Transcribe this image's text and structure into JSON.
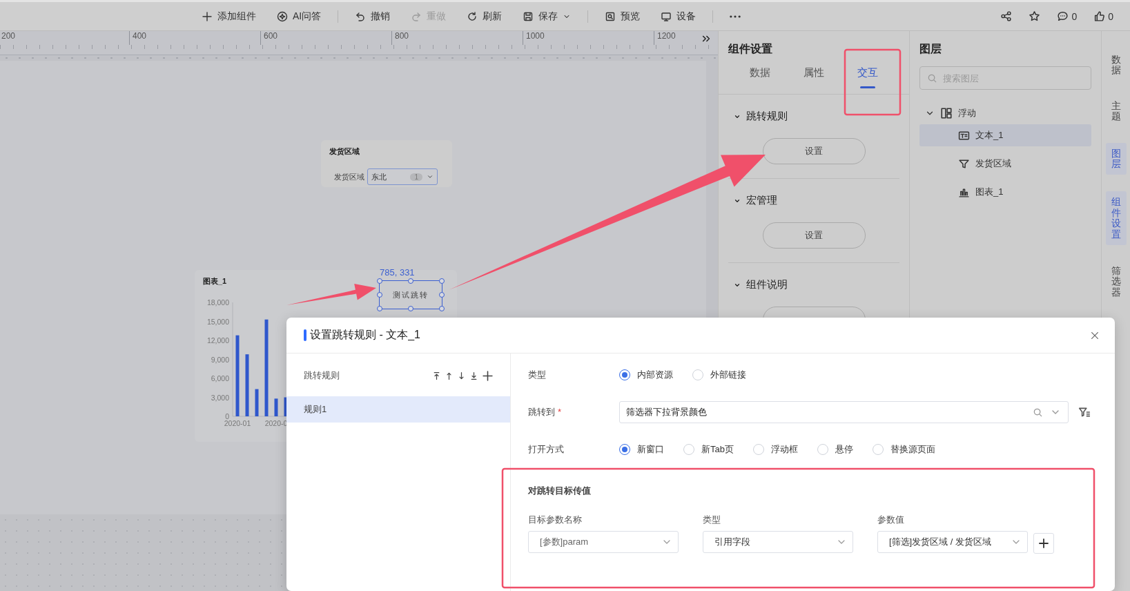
{
  "toolbar": {
    "items": [
      {
        "kind": "add",
        "label": "添加组件",
        "disabled": false
      },
      {
        "kind": "ai",
        "label": "AI问答",
        "disabled": false
      },
      {
        "kind": "undo",
        "label": "撤销",
        "disabled": false
      },
      {
        "kind": "redo",
        "label": "重做",
        "disabled": true
      },
      {
        "kind": "refresh",
        "label": "刷新",
        "disabled": false
      },
      {
        "kind": "save",
        "label": "保存",
        "disabled": false
      },
      {
        "kind": "preview",
        "label": "预览",
        "disabled": false
      },
      {
        "kind": "device",
        "label": "设备",
        "disabled": false
      },
      {
        "kind": "more",
        "disabled": false
      }
    ],
    "actions": [
      {
        "kind": "share"
      },
      {
        "kind": "star"
      },
      {
        "kind": "comment",
        "count": "0"
      },
      {
        "kind": "like",
        "count": "0"
      }
    ]
  },
  "ruler": {
    "labels": [
      "200",
      "400",
      "600",
      "800",
      "1000",
      "1200"
    ]
  },
  "canvas": {
    "filter": {
      "title": "发货区域",
      "label": "发货区域",
      "value": "东北",
      "count": "1"
    },
    "textbox": {
      "text": "测试跳转",
      "position": "785, 331",
      "selected": true
    },
    "chart": {
      "title": "图表_1",
      "chart_data": {
        "type": "bar",
        "categories": [
          "2020-01",
          null,
          null,
          null,
          "2020-0",
          null
        ],
        "values": [
          12800,
          9800,
          4300,
          15300,
          2800,
          3000
        ],
        "ylim": [
          0,
          18000
        ],
        "yticks": [
          {
            "value": 0,
            "label": "0"
          },
          {
            "value": 3000,
            "label": "3,000"
          },
          {
            "value": 6000,
            "label": "6,000"
          },
          {
            "value": 9000,
            "label": "9,000"
          },
          {
            "value": 12000,
            "label": "12,000"
          },
          {
            "value": 15000,
            "label": "15,000"
          },
          {
            "value": 18000,
            "label": "18,000"
          }
        ]
      }
    }
  },
  "settings": {
    "title": "组件设置",
    "tabs": [
      {
        "label": "数据",
        "selected": false
      },
      {
        "label": "属性",
        "selected": false
      },
      {
        "label": "交互",
        "selected": true
      }
    ],
    "sections": [
      {
        "title": "跳转规则",
        "expanded": true,
        "button": "设置"
      },
      {
        "title": "宏管理",
        "expanded": true,
        "button": "设置"
      },
      {
        "title": "组件说明",
        "expanded": true
      }
    ]
  },
  "layers": {
    "title": "图层",
    "search_placeholder": "搜索图层",
    "tree": [
      {
        "label": "浮动",
        "kind": "group",
        "expanded": true,
        "selected": false,
        "children": [
          {
            "label": "文本_1",
            "kind": "text",
            "selected": true
          },
          {
            "label": "发货区域",
            "kind": "filter",
            "selected": false
          },
          {
            "label": "图表_1",
            "kind": "chart",
            "selected": false
          }
        ]
      }
    ]
  },
  "rail": [
    {
      "label": "数据",
      "selected": false
    },
    {
      "label": "主题",
      "selected": false
    },
    {
      "label": "图层",
      "selected": true
    },
    {
      "label": "组件设置",
      "selected": true
    },
    {
      "label": "筛选器",
      "selected": false
    }
  ],
  "dialog": {
    "title": "设置跳转规则 - 文本_1",
    "rules_header": "跳转规则",
    "rules": [
      {
        "label": "规则1",
        "selected": true
      }
    ],
    "type": {
      "label": "类型",
      "options": [
        {
          "label": "内部资源",
          "selected": true
        },
        {
          "label": "外部链接",
          "selected": false
        }
      ]
    },
    "target": {
      "label": "跳转到",
      "required_mark": "*",
      "value": "筛选器下拉背景颜色"
    },
    "open_mode": {
      "label": "打开方式",
      "options": [
        {
          "label": "新窗口",
          "selected": true
        },
        {
          "label": "新Tab页",
          "selected": false
        },
        {
          "label": "浮动框",
          "selected": false
        },
        {
          "label": "悬停",
          "selected": false
        },
        {
          "label": "替换源页面",
          "selected": false
        }
      ]
    },
    "params": {
      "title": "对跳转目标传值",
      "columns": [
        "目标参数名称",
        "类型",
        "参数值"
      ],
      "row": [
        "[参数]param",
        "引用字段",
        "[筛选]发货区域 / 发货区域"
      ]
    }
  }
}
